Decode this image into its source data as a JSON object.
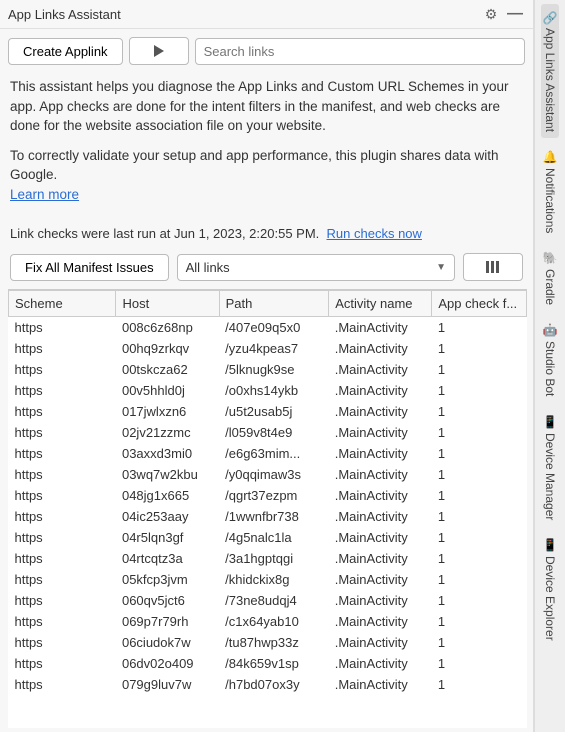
{
  "titleBar": {
    "title": "App Links Assistant"
  },
  "toolbar": {
    "createBtn": "Create Applink",
    "searchPlaceholder": "Search links"
  },
  "description": {
    "p1": "This assistant helps you diagnose the App Links and Custom URL Schemes in your app. App checks are done for the intent filters in the manifest, and web checks are done for the website association file on your website.",
    "p2": "To correctly validate your setup and app performance, this plugin shares data with Google.",
    "learnMore": "Learn more"
  },
  "status": {
    "lastRun": "Link checks were last run at Jun 1, 2023, 2:20:55 PM.",
    "runNow": "Run checks now"
  },
  "controls": {
    "fixBtn": "Fix All Manifest Issues",
    "filterSelect": "All links"
  },
  "table": {
    "headers": {
      "scheme": "Scheme",
      "host": "Host",
      "path": "Path",
      "activity": "Activity name",
      "check": "App check f..."
    },
    "rows": [
      {
        "scheme": "https",
        "host": "008c6z68np",
        "path": "/407e09q5x0",
        "activity": ".MainActivity",
        "check": "1"
      },
      {
        "scheme": "https",
        "host": "00hq9zrkqv",
        "path": "/yzu4kpeas7",
        "activity": ".MainActivity",
        "check": "1"
      },
      {
        "scheme": "https",
        "host": "00tskcza62",
        "path": "/5lknugk9se",
        "activity": ".MainActivity",
        "check": "1"
      },
      {
        "scheme": "https",
        "host": "00v5hhld0j",
        "path": "/o0xhs14ykb",
        "activity": ".MainActivity",
        "check": "1"
      },
      {
        "scheme": "https",
        "host": "017jwlxzn6",
        "path": "/u5t2usab5j",
        "activity": ".MainActivity",
        "check": "1"
      },
      {
        "scheme": "https",
        "host": "02jv21zzmc",
        "path": "/l059v8t4e9",
        "activity": ".MainActivity",
        "check": "1"
      },
      {
        "scheme": "https",
        "host": "03axxd3mi0",
        "path": "/e6g63mim...",
        "activity": ".MainActivity",
        "check": "1"
      },
      {
        "scheme": "https",
        "host": "03wq7w2kbu",
        "path": "/y0qqimaw3s",
        "activity": ".MainActivity",
        "check": "1"
      },
      {
        "scheme": "https",
        "host": "048jg1x665",
        "path": "/qgrt37ezpm",
        "activity": ".MainActivity",
        "check": "1"
      },
      {
        "scheme": "https",
        "host": "04ic253aay",
        "path": "/1wwnfbr738",
        "activity": ".MainActivity",
        "check": "1"
      },
      {
        "scheme": "https",
        "host": "04r5lqn3gf",
        "path": "/4g5nalc1la",
        "activity": ".MainActivity",
        "check": "1"
      },
      {
        "scheme": "https",
        "host": "04rtcqtz3a",
        "path": "/3a1hgptqgi",
        "activity": ".MainActivity",
        "check": "1"
      },
      {
        "scheme": "https",
        "host": "05kfcp3jvm",
        "path": "/khidckix8g",
        "activity": ".MainActivity",
        "check": "1"
      },
      {
        "scheme": "https",
        "host": "060qv5jct6",
        "path": "/73ne8udqj4",
        "activity": ".MainActivity",
        "check": "1"
      },
      {
        "scheme": "https",
        "host": "069p7r79rh",
        "path": "/c1x64yab10",
        "activity": ".MainActivity",
        "check": "1"
      },
      {
        "scheme": "https",
        "host": "06ciudok7w",
        "path": "/tu87hwp33z",
        "activity": ".MainActivity",
        "check": "1"
      },
      {
        "scheme": "https",
        "host": "06dv02o409",
        "path": "/84k659v1sp",
        "activity": ".MainActivity",
        "check": "1"
      },
      {
        "scheme": "https",
        "host": "079g9luv7w",
        "path": "/h7bd07ox3y",
        "activity": ".MainActivity",
        "check": "1"
      }
    ]
  },
  "rail": {
    "items": [
      {
        "label": "App Links Assistant",
        "icon": "link"
      },
      {
        "label": "Notifications",
        "icon": "bell"
      },
      {
        "label": "Gradle",
        "icon": "elephant"
      },
      {
        "label": "Studio Bot",
        "icon": "bot"
      },
      {
        "label": "Device Manager",
        "icon": "phone"
      },
      {
        "label": "Device Explorer",
        "icon": "phone"
      }
    ]
  }
}
